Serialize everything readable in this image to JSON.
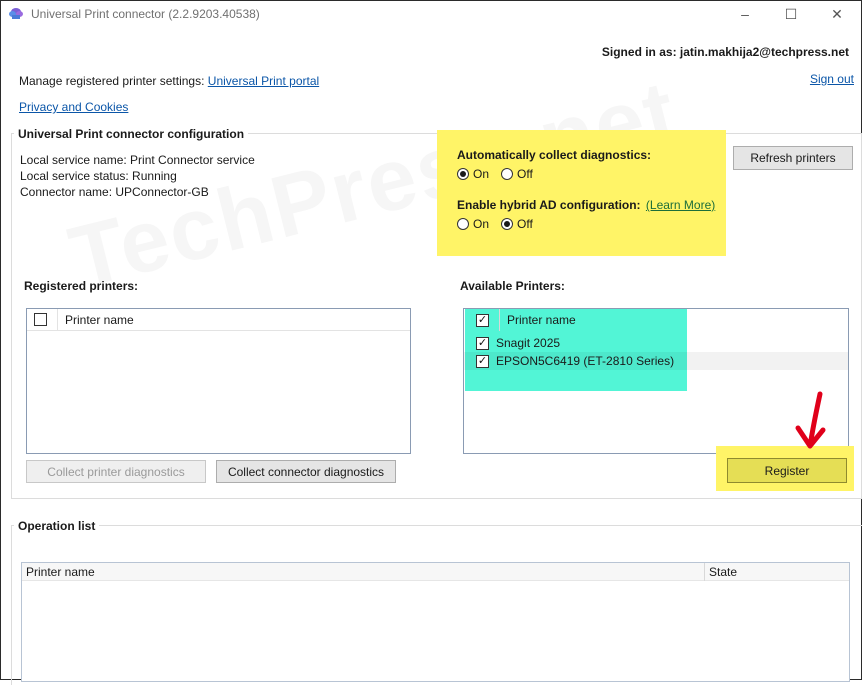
{
  "window": {
    "title": "Universal Print connector (2.2.9203.40538)",
    "minimize": "–",
    "maximize": "☐",
    "close": "✕"
  },
  "account": {
    "signed_in": "Signed in as: jatin.makhija2@techpress.net",
    "sign_out": "Sign out"
  },
  "links": {
    "manage_prefix": "Manage registered printer settings:",
    "portal": "Universal Print portal",
    "privacy": "Privacy and Cookies"
  },
  "config": {
    "group_title": "Universal Print connector configuration",
    "service_name": "Local service name: Print Connector service",
    "service_status": "Local service status: Running",
    "connector_name": "Connector name: UPConnector-GB",
    "auto_diag_label": "Automatically collect diagnostics:",
    "auto_diag_on": "On",
    "auto_diag_off": "Off",
    "auto_diag_value": "On",
    "hybrid_label": "Enable hybrid AD configuration:",
    "learn_more": "(Learn More)",
    "hybrid_on": "On",
    "hybrid_off": "Off",
    "hybrid_value": "Off",
    "refresh_button": "Refresh printers"
  },
  "registered": {
    "label": "Registered printers:",
    "column": "Printer name",
    "header_checked": false,
    "items": []
  },
  "available": {
    "label": "Available Printers:",
    "column": "Printer name",
    "header_checked": true,
    "items": [
      {
        "name": "Snagit 2025",
        "checked": true
      },
      {
        "name": "EPSON5C6419 (ET-2810 Series)",
        "checked": true
      }
    ]
  },
  "actions": {
    "collect_printer_diag": "Collect printer diagnostics",
    "collect_connector_diag": "Collect connector diagnostics",
    "register": "Register"
  },
  "operations": {
    "group_title": "Operation list",
    "col_printer": "Printer name",
    "col_state": "State"
  },
  "watermark": "TechPress.net",
  "colors": {
    "highlight_yellow": "#fff467",
    "highlight_cyan": "#52f5d6",
    "arrow_red": "#e0001a",
    "link_blue": "#0b56a8"
  }
}
